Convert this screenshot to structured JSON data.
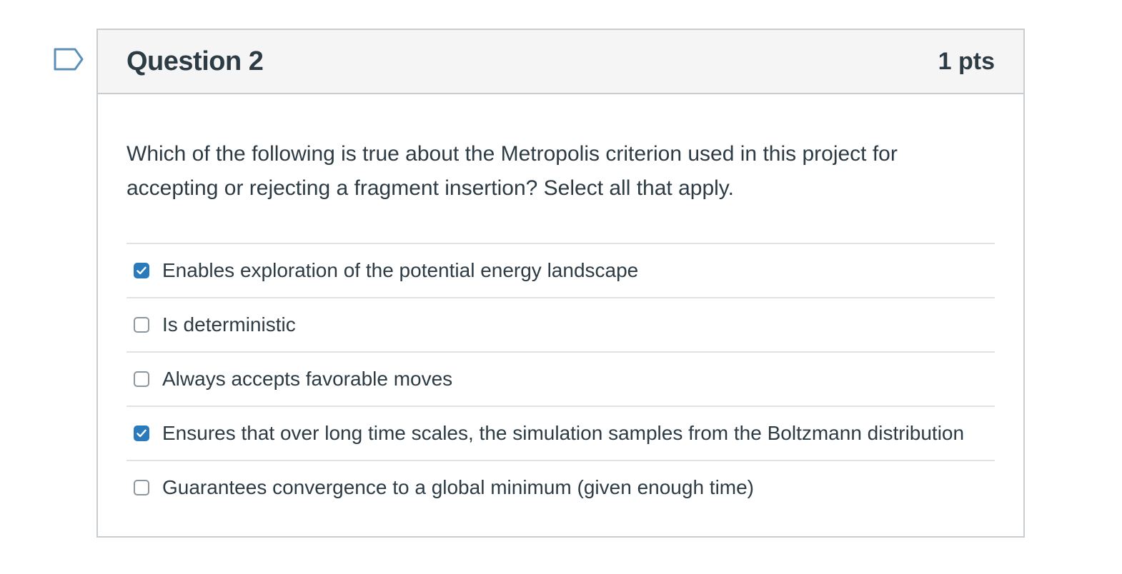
{
  "question": {
    "title": "Question 2",
    "points": "1 pts",
    "text": "Which of the following is true about the Metropolis criterion used in this project for accepting or rejecting a fragment insertion? Select all that apply."
  },
  "answers": [
    {
      "label": "Enables exploration of the potential energy landscape",
      "checked": true
    },
    {
      "label": "Is deterministic",
      "checked": false
    },
    {
      "label": "Always accepts favorable moves",
      "checked": false
    },
    {
      "label": "Ensures that over long time scales, the simulation samples from the Boltzmann distribution",
      "checked": true
    },
    {
      "label": "Guarantees convergence to a global minimum (given enough time)",
      "checked": false
    }
  ],
  "icons": {
    "flag": "flag-bookmark-icon",
    "check": "checkmark-icon"
  },
  "colors": {
    "accent": "#2b7abc",
    "text": "#2d3b45",
    "header_bg": "#f5f5f5",
    "border": "#c7cdd1"
  }
}
